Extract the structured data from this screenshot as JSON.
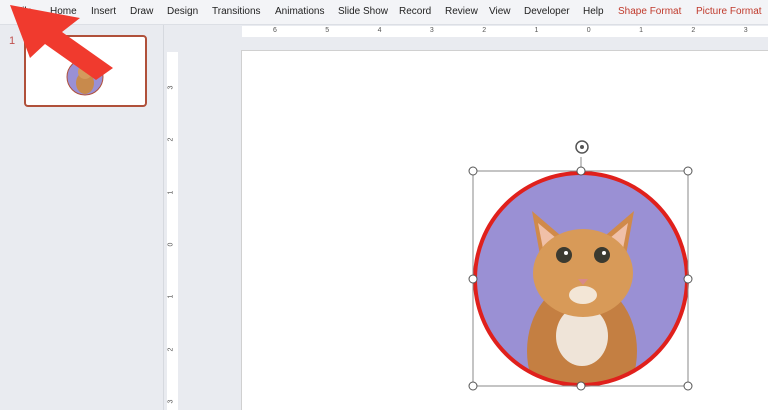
{
  "menu": [
    "File",
    "Home",
    "Insert",
    "Draw",
    "Design",
    "Transitions",
    "Animations",
    "Slide Show",
    "Record",
    "Review",
    "View",
    "Developer",
    "Help"
  ],
  "context_tabs": [
    "Shape Format",
    "Picture Format"
  ],
  "slide_panel": {
    "slide_number": "1"
  },
  "hruler": [
    "6",
    "5",
    "4",
    "3",
    "2",
    "1",
    "0",
    "1",
    "2",
    "3"
  ],
  "vruler": [
    "3",
    "2",
    "1",
    "0",
    "1",
    "2",
    "3"
  ],
  "colors": {
    "accent": "#c0504d",
    "arrow": "#f03a2e",
    "circle_border": "#e0201c",
    "circle_fill": "#9a90d4"
  }
}
